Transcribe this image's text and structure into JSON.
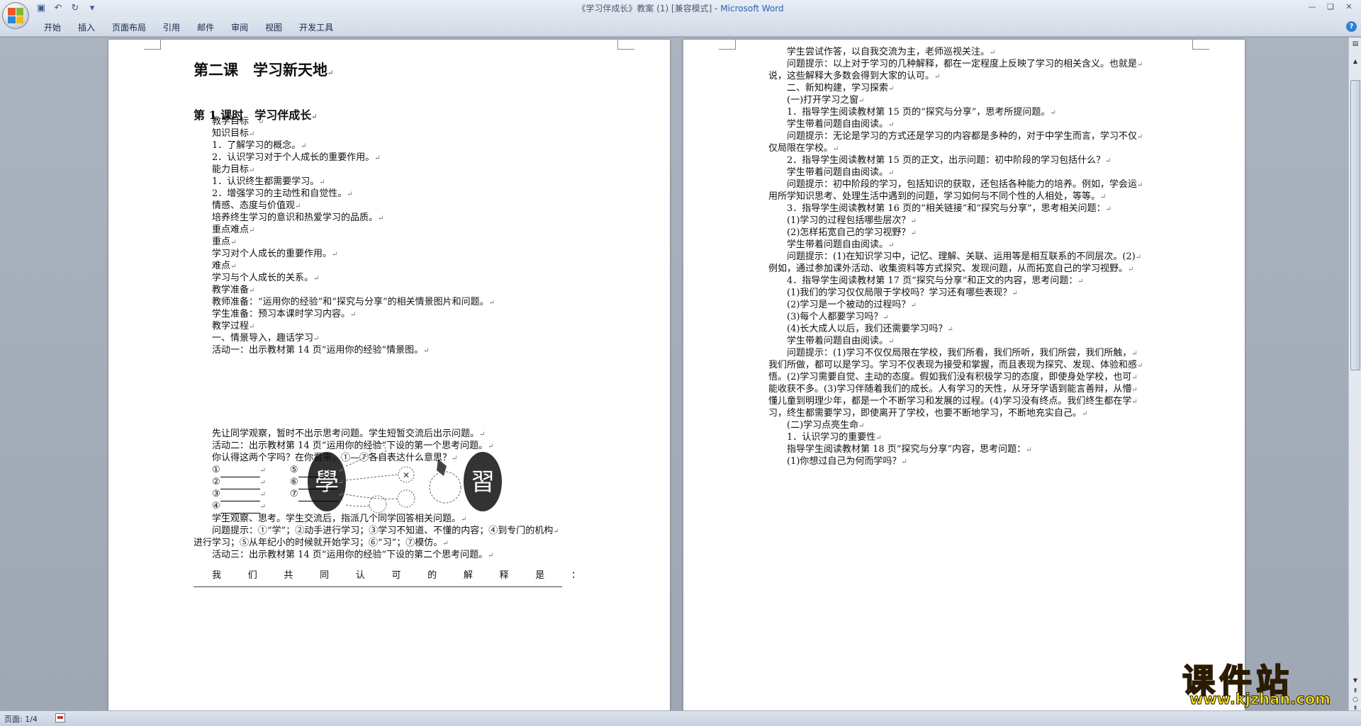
{
  "window": {
    "title_doc": "《学习伴成长》教案 (1) [兼容模式] - ",
    "title_app": "Microsoft Word"
  },
  "ribbon": {
    "tabs": [
      "开始",
      "插入",
      "页面布局",
      "引用",
      "邮件",
      "审阅",
      "视图",
      "开发工具"
    ]
  },
  "status": {
    "page_label": "页面: 1/4"
  },
  "watermark": {
    "text_cn": "课件站",
    "url": "www.kjzhan.com"
  },
  "page1": {
    "title": "第二课　学习新天地",
    "subtitle": "第 1 课时　学习伴成长",
    "lines": [
      "教学目标　",
      "知识目标",
      "1．了解学习的概念。",
      "2．认识学习对于个人成长的重要作用。",
      "能力目标",
      "1．认识终生都需要学习。",
      "2．增强学习的主动性和自觉性。",
      "情感、态度与价值观",
      "培养终生学习的意识和热爱学习的品质。",
      "重点难点",
      "重点",
      "学习对个人成长的重要作用。",
      "难点",
      "学习与个人成长的关系。",
      "教学准备",
      "教师准备：“运用你的经验”和“探究与分享”的相关情景图片和问题。",
      "学生准备：预习本课时学习内容。",
      "教学过程",
      "一、情景导入，趣话学习",
      "活动一：出示教材第 14 页“运用你的经验”情景图。"
    ],
    "after_figure": [
      "先让同学观察，暂时不出示思考问题。学生短暂交流后出示问题。",
      "活动二：出示教材第 14 页“运用你的经验”下设的第一个思考问题。",
      "你认得这两个字吗？在你看来，①—⑦各自表达什么意思？"
    ],
    "blanks": [
      [
        "①",
        "⑤"
      ],
      [
        "②",
        "⑥"
      ],
      [
        "③",
        "⑦"
      ],
      [
        "④",
        ""
      ]
    ],
    "after_blanks": [
      "学生观察、思考。学生交流后，指派几个同学回答相关问题。",
      "问题提示：①“学”；②动手进行学习；③学习不知道、不懂的内容；④到专门的机构",
      "进行学习；⑤从年纪小的时候就开始学习；⑥“习”；⑦模仿。",
      "活动三：出示教材第 14 页“运用你的经验”下设的第二个思考问题。"
    ],
    "spread_line": [
      "我",
      "们",
      "共",
      "同",
      "认",
      "可",
      "的",
      "解",
      "释",
      "是",
      "："
    ]
  },
  "page2": {
    "lines": [
      {
        "t": "学生尝试作答，以自我交流为主，老师巡视关注。",
        "i": true
      },
      {
        "t": "问题提示：以上对于学习的几种解释，都在一定程度上反映了学习的相关含义。也就是",
        "i": true
      },
      {
        "t": "说，这些解释大多数会得到大家的认可。",
        "i": false
      },
      {
        "t": "二、新知构建，学习探索",
        "i": true
      },
      {
        "t": "(一)打开学习之窗",
        "i": true
      },
      {
        "t": "1．指导学生阅读教材第 15 页的“探究与分享”，思考所提问题。",
        "i": true
      },
      {
        "t": "学生带着问题自由阅读。",
        "i": true
      },
      {
        "t": "问题提示：无论是学习的方式还是学习的内容都是多种的，对于中学生而言，学习不仅",
        "i": true
      },
      {
        "t": "仅局限在学校。",
        "i": false
      },
      {
        "t": "2．指导学生阅读教材第 15 页的正文，出示问题：初中阶段的学习包括什么？",
        "i": true
      },
      {
        "t": "学生带着问题自由阅读。",
        "i": true
      },
      {
        "t": "问题提示：初中阶段的学习，包括知识的获取，还包括各种能力的培养。例如，学会运",
        "i": true
      },
      {
        "t": "用所学知识思考、处理生活中遇到的问题，学习如何与不同个性的人相处，等等。",
        "i": false
      },
      {
        "t": "3．指导学生阅读教材第 16 页的“相关链接”和“探究与分享”，思考相关问题：",
        "i": true
      },
      {
        "t": "(1)学习的过程包括哪些层次？",
        "i": true
      },
      {
        "t": "(2)怎样拓宽自己的学习视野？",
        "i": true
      },
      {
        "t": "学生带着问题自由阅读。",
        "i": true
      },
      {
        "t": "问题提示：(1)在知识学习中，记忆、理解、关联、运用等是相互联系的不同层次。(2)",
        "i": true
      },
      {
        "t": "例如，通过参加课外活动、收集资料等方式探究、发现问题，从而拓宽自己的学习视野。",
        "i": false
      },
      {
        "t": "4．指导学生阅读教材第 17 页“探究与分享”和正文的内容，思考问题：",
        "i": true
      },
      {
        "t": "(1)我们的学习仅仅局限于学校吗？学习还有哪些表现？",
        "i": true
      },
      {
        "t": "(2)学习是一个被动的过程吗？",
        "i": true
      },
      {
        "t": "(3)每个人都要学习吗？",
        "i": true
      },
      {
        "t": "(4)长大成人以后，我们还需要学习吗？",
        "i": true
      },
      {
        "t": "学生带着问题自由阅读。",
        "i": true
      },
      {
        "t": "问题提示：(1)学习不仅仅局限在学校，我们所看，我们所听，我们所尝，我们所触，",
        "i": true
      },
      {
        "t": "我们所做，都可以是学习。学习不仅表现为接受和掌握，而且表现为探究、发现、体验和感",
        "i": false
      },
      {
        "t": "悟。(2)学习需要自觉、主动的态度。假如我们没有积极学习的态度，即使身处学校，也可",
        "i": false
      },
      {
        "t": "能收获不多。(3)学习伴随着我们的成长。人有学习的天性，从牙牙学语到能言善辩，从懵",
        "i": false
      },
      {
        "t": "懂儿童到明理少年，都是一个不断学习和发展的过程。(4)学习没有终点。我们终生都在学",
        "i": false
      },
      {
        "t": "习，终生都需要学习，即使离开了学校，也要不断地学习，不断地充实自己。",
        "i": false
      },
      {
        "t": "(二)学习点亮生命",
        "i": true
      },
      {
        "t": "1．认识学习的重要性",
        "i": true
      },
      {
        "t": "指导学生阅读教材第 18 页“探究与分享”内容，思考问题：",
        "i": true
      },
      {
        "t": "(1)你想过自己为何而学吗？",
        "i": true
      }
    ]
  }
}
